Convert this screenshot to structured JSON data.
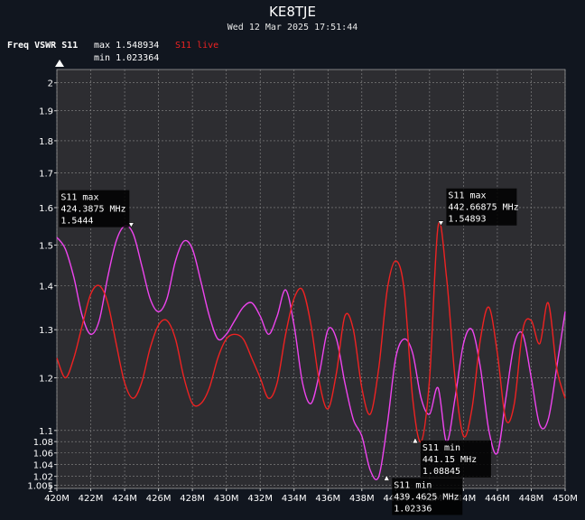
{
  "header": {
    "title": "KE8TJE",
    "datetime": "Wed 12 Mar 2025 17:51:44"
  },
  "legend": {
    "param": "Freq VSWR S11",
    "max_text": "max 1.548934",
    "min_text": "min 1.023364",
    "live_label": "S11 live",
    "live_color": "#ee2222",
    "stored_color": "#ee44ee"
  },
  "chart_data": {
    "type": "line",
    "title": "",
    "xlabel": "",
    "ylabel": "",
    "x_unit": "MHz",
    "xlim": [
      420,
      450
    ],
    "ylim": [
      1,
      2.05
    ],
    "y_scale": "vswr-reflection",
    "grid": true,
    "x_ticks": [
      420,
      422,
      424,
      426,
      428,
      430,
      432,
      434,
      436,
      438,
      440,
      442,
      444,
      446,
      448,
      450
    ],
    "x_tick_labels": [
      "420M",
      "422M",
      "424M",
      "426M",
      "428M",
      "430M",
      "432M",
      "434M",
      "436M",
      "438M",
      "440M",
      "442M",
      "444M",
      "446M",
      "448M",
      "450M"
    ],
    "y_ticks": [
      1,
      1.005,
      1.02,
      1.04,
      1.06,
      1.08,
      1.1,
      1.2,
      1.3,
      1.4,
      1.5,
      1.6,
      1.7,
      1.8,
      1.9,
      2
    ],
    "y_tick_labels": [
      "1",
      "1.005",
      "1.02",
      "1.04",
      "1.06",
      "1.08",
      "1.1",
      "1.2",
      "1.3",
      "1.4",
      "1.5",
      "1.6",
      "1.7",
      "1.8",
      "1.9",
      "2"
    ],
    "series": [
      {
        "name": "S11 live",
        "color": "#ee2222",
        "x": [
          420,
          420.5,
          421,
          421.5,
          422,
          422.5,
          423,
          423.5,
          424,
          424.5,
          425,
          425.5,
          426,
          426.5,
          427,
          427.5,
          428,
          428.5,
          429,
          429.5,
          430,
          430.5,
          431,
          431.5,
          432,
          432.5,
          433,
          433.5,
          434,
          434.5,
          435,
          435.5,
          436,
          436.5,
          437,
          437.5,
          438,
          438.5,
          439,
          439.5,
          440,
          440.5,
          441,
          441.5,
          442,
          442.5,
          443,
          443.5,
          444,
          444.5,
          445,
          445.5,
          446,
          446.5,
          447,
          447.5,
          448,
          448.5,
          449,
          449.5,
          450
        ],
        "y": [
          1.24,
          1.2,
          1.24,
          1.31,
          1.38,
          1.4,
          1.36,
          1.27,
          1.19,
          1.16,
          1.19,
          1.26,
          1.31,
          1.32,
          1.28,
          1.2,
          1.15,
          1.15,
          1.18,
          1.24,
          1.28,
          1.29,
          1.28,
          1.24,
          1.2,
          1.16,
          1.19,
          1.29,
          1.37,
          1.39,
          1.31,
          1.19,
          1.14,
          1.21,
          1.33,
          1.3,
          1.18,
          1.13,
          1.22,
          1.39,
          1.46,
          1.39,
          1.16,
          1.08,
          1.2,
          1.55,
          1.42,
          1.2,
          1.09,
          1.14,
          1.28,
          1.35,
          1.25,
          1.12,
          1.15,
          1.3,
          1.32,
          1.27,
          1.36,
          1.22,
          1.16
        ]
      },
      {
        "name": "",
        "color": "#ee44ee",
        "x": [
          420,
          420.5,
          421,
          421.5,
          422,
          422.5,
          423,
          423.5,
          424,
          424.5,
          425,
          425.5,
          426,
          426.5,
          427,
          427.5,
          428,
          428.5,
          429,
          429.5,
          430,
          430.5,
          431,
          431.5,
          432,
          432.5,
          433,
          433.5,
          434,
          434.5,
          435,
          435.5,
          436,
          436.5,
          437,
          437.5,
          438,
          438.5,
          439,
          439.5,
          440,
          440.5,
          441,
          441.5,
          442,
          442.5,
          443,
          443.5,
          444,
          444.5,
          445,
          445.5,
          446,
          446.5,
          447,
          447.5,
          448,
          448.5,
          449,
          449.5,
          450
        ],
        "y": [
          1.52,
          1.49,
          1.42,
          1.33,
          1.29,
          1.32,
          1.42,
          1.51,
          1.55,
          1.53,
          1.45,
          1.37,
          1.34,
          1.37,
          1.46,
          1.51,
          1.49,
          1.41,
          1.33,
          1.28,
          1.29,
          1.32,
          1.35,
          1.36,
          1.33,
          1.29,
          1.33,
          1.39,
          1.31,
          1.19,
          1.15,
          1.21,
          1.3,
          1.28,
          1.19,
          1.12,
          1.09,
          1.03,
          1.02,
          1.11,
          1.24,
          1.28,
          1.25,
          1.16,
          1.13,
          1.18,
          1.08,
          1.16,
          1.27,
          1.3,
          1.22,
          1.1,
          1.06,
          1.16,
          1.27,
          1.29,
          1.2,
          1.11,
          1.12,
          1.22,
          1.34
        ]
      }
    ],
    "markers": [
      {
        "id": "stored-max",
        "dir": "down",
        "x": 424.3875,
        "y": 1.5444,
        "lines": [
          "S11 max",
          "424.3875 MHz",
          "1.5444"
        ],
        "box_side": "left"
      },
      {
        "id": "live-max",
        "dir": "down",
        "x": 442.66875,
        "y": 1.54893,
        "lines": [
          "S11 max",
          "442.66875 MHz",
          "1.54893"
        ],
        "box_side": "right"
      },
      {
        "id": "live-min",
        "dir": "up",
        "x": 441.15,
        "y": 1.08845,
        "lines": [
          "S11 min",
          "441.15 MHz",
          "1.08845"
        ],
        "box_side": "right"
      },
      {
        "id": "stored-min",
        "dir": "up",
        "x": 439.4625,
        "y": 1.02336,
        "lines": [
          "S11 min",
          "439.4625 MHz",
          "1.02336"
        ],
        "box_side": "right"
      }
    ]
  }
}
